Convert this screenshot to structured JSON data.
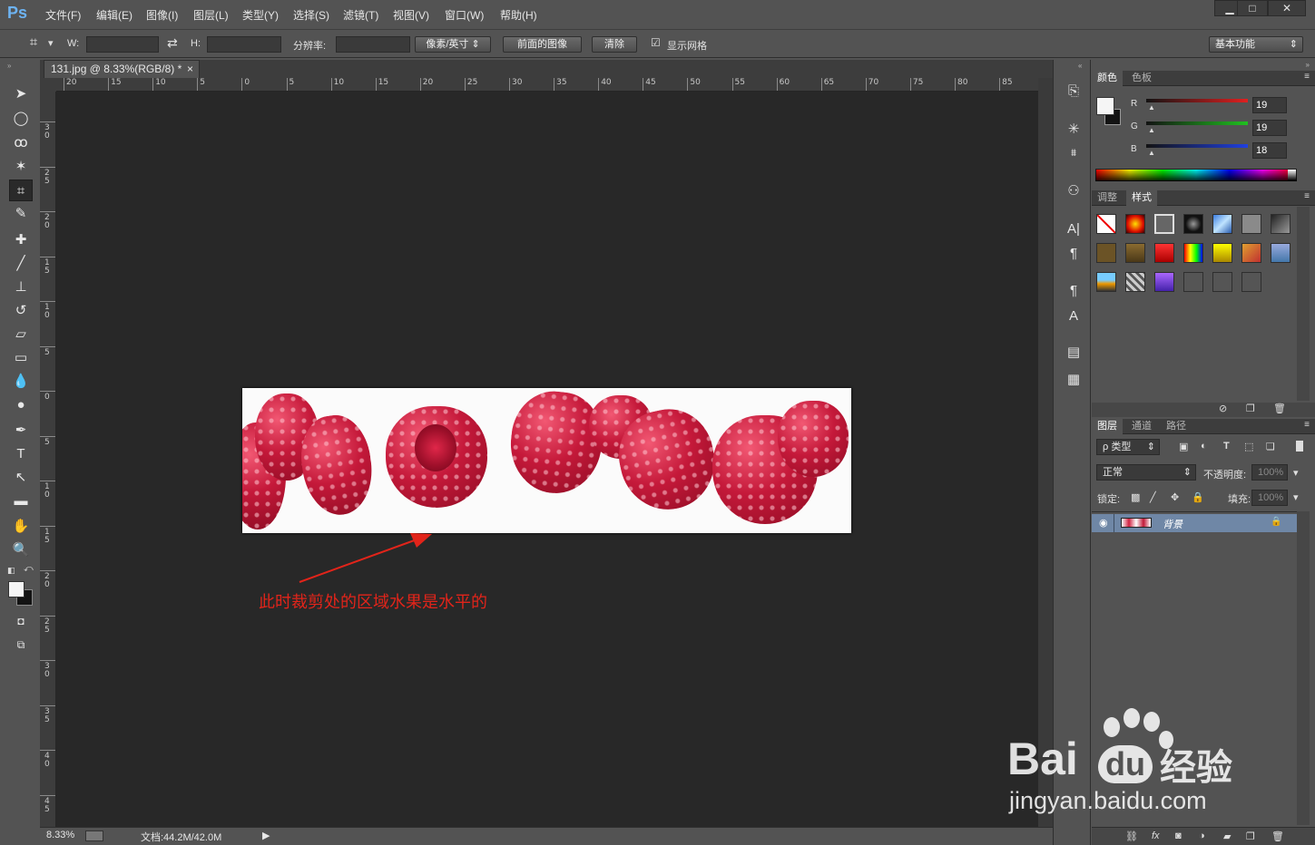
{
  "app": {
    "logo": "Ps"
  },
  "menu": [
    {
      "label": "文件(F)"
    },
    {
      "label": "编辑(E)"
    },
    {
      "label": "图像(I)"
    },
    {
      "label": "图层(L)"
    },
    {
      "label": "类型(Y)"
    },
    {
      "label": "选择(S)"
    },
    {
      "label": "滤镜(T)"
    },
    {
      "label": "视图(V)"
    },
    {
      "label": "窗口(W)"
    },
    {
      "label": "帮助(H)"
    }
  ],
  "window_controls": {
    "minimize": "▁",
    "maximize": "□",
    "close": "✕"
  },
  "options": {
    "w_label": "W:",
    "h_label": "H:",
    "resolution_label": "分辨率:",
    "unit_select": "像素/英寸",
    "front_image_button": "前面的图像",
    "clear_button": "清除",
    "show_grid_label": "显示网格",
    "show_grid_checked": true,
    "workspace_select": "基本功能"
  },
  "document": {
    "tab_title": "131.jpg @ 8.33%(RGB/8) *",
    "tab_close": "×",
    "zoom": "8.33%",
    "doc_info": "文档:44.2M/42.0M"
  },
  "ruler": {
    "top_labels": [
      "20",
      "15",
      "10",
      "5",
      "0",
      "5",
      "10",
      "15",
      "20",
      "25",
      "30",
      "35",
      "40",
      "45",
      "50",
      "55",
      "60",
      "65",
      "70",
      "75",
      "80",
      "85"
    ],
    "left_labels": [
      "3 0",
      "2 5",
      "2 0",
      "1 5",
      "1 0",
      "5",
      "0",
      "5",
      "1 0",
      "1 5",
      "2 0",
      "2 5",
      "3 0",
      "3 5",
      "4 0",
      "4 5"
    ]
  },
  "annotation": {
    "text": "此时裁剪处的区域水果是水平的",
    "color": "#e2241a"
  },
  "color_panel": {
    "tabs": [
      "颜色",
      "色板"
    ],
    "channels": [
      {
        "name": "R",
        "value": "19",
        "color": "#e02020"
      },
      {
        "name": "G",
        "value": "19",
        "color": "#20c020"
      },
      {
        "name": "B",
        "value": "18",
        "color": "#2040e0"
      }
    ]
  },
  "styles_panel": {
    "tabs": [
      "调整",
      "样式"
    ]
  },
  "layers_panel": {
    "tabs": [
      "图层",
      "通道",
      "路径"
    ],
    "filter_label": "ρ 类型",
    "blend_mode": "正常",
    "opacity_label": "不透明度:",
    "opacity_value": "100%",
    "lock_label": "锁定:",
    "fill_label": "填充:",
    "fill_value": "100%",
    "layers": [
      {
        "name": "背景",
        "visible": true,
        "locked": true
      }
    ]
  },
  "watermark": {
    "brand": "Bai",
    "brand2": "du",
    "cn": "经验",
    "url": "jingyan.baidu.com"
  }
}
